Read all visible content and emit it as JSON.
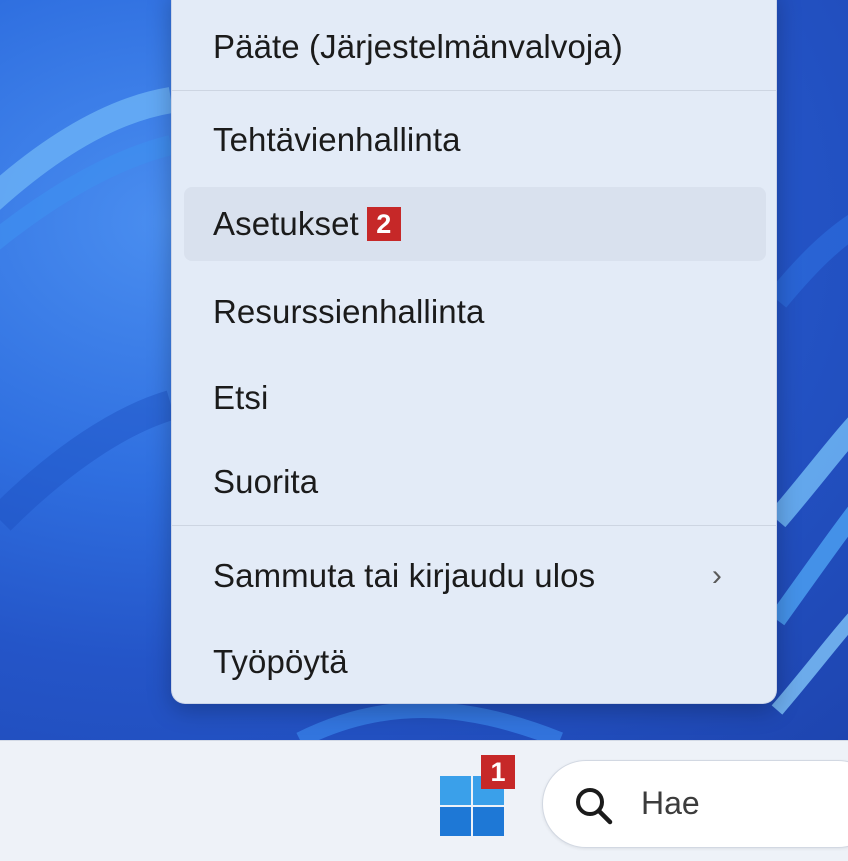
{
  "menu": {
    "items": [
      {
        "label": "Pääte (Järjestelmänvalvoja)"
      },
      {
        "label": "Tehtävienhallinta"
      },
      {
        "label": "Asetukset",
        "badge": "2"
      },
      {
        "label": "Resurssienhallinta"
      },
      {
        "label": "Etsi"
      },
      {
        "label": "Suorita"
      },
      {
        "label": "Sammuta tai kirjaudu ulos",
        "chevron": "›"
      },
      {
        "label": "Työpöytä"
      }
    ]
  },
  "taskbar": {
    "start_badge": "1",
    "search_placeholder": "Hae"
  },
  "colors": {
    "badge": "#c62828",
    "start_logo_top": "#3aa0ea",
    "start_logo_bottom": "#1e78d6",
    "menu_bg": "#e3ebf7"
  }
}
